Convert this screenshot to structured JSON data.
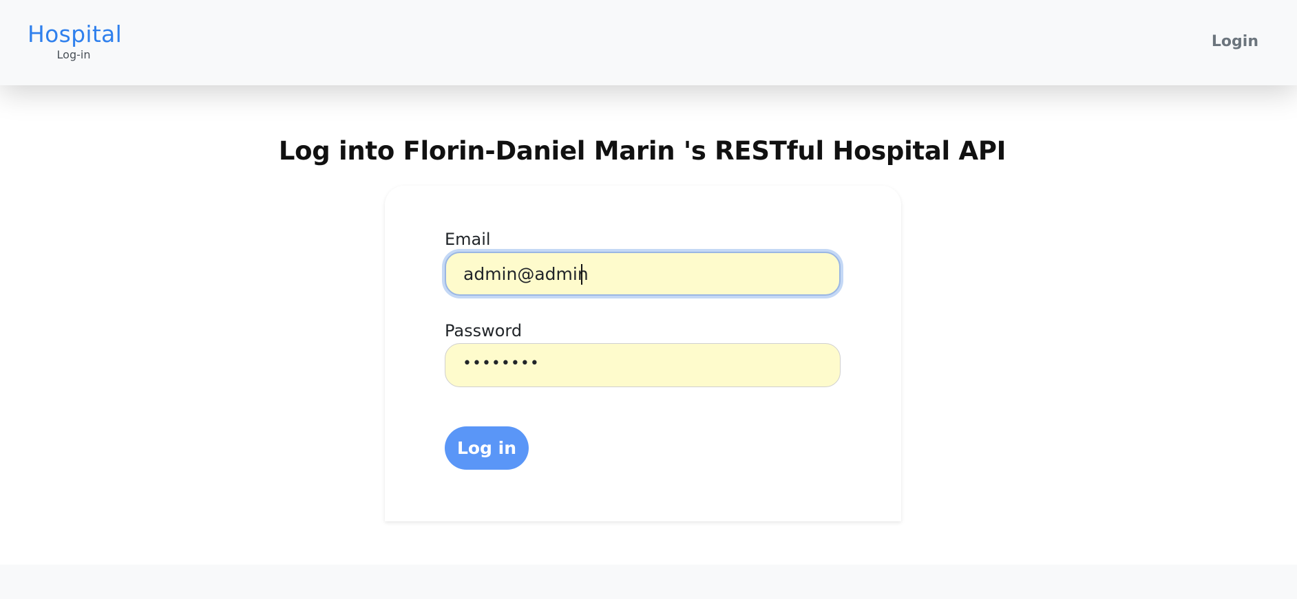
{
  "navbar": {
    "brand_title": "Hospital",
    "brand_subtitle": "Log-in",
    "login_link": "Login"
  },
  "page": {
    "title": "Log into Florin-Daniel Marin 's RESTful Hospital API"
  },
  "form": {
    "email_label": "Email",
    "email_value": "admin@admin",
    "password_label": "Password",
    "password_masked": "••••••••",
    "submit_label": "Log in"
  },
  "colors": {
    "brand": "#2f80ed",
    "button": "#5a96f7",
    "autofill_bg": "#fefbcc",
    "navbar_bg": "#f8f9fa"
  }
}
